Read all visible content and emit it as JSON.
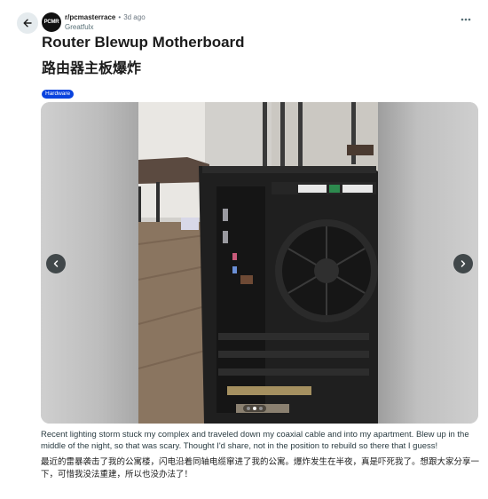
{
  "post": {
    "subreddit": "r/pcmasterrace",
    "separator": "•",
    "time_ago": "3d ago",
    "username": "Greatfulx",
    "avatar_text": "PCMR",
    "title_en": "Router Blewup Motherboard",
    "title_zh": "路由器主板爆炸",
    "flair": "Hardware",
    "flair_color": "#0a43de",
    "body_en": "Recent lighting storm stuck my complex and traveled down my coaxial cable and into my apartment. Blew up in the middle of the night, so that was scary. Thought I'd share, not in the position to rebuild so there that I guess!",
    "body_zh": "最近的雷暴袭击了我的公寓楼，闪电沿着同轴电缆窜进了我的公寓。爆炸发生在半夜，真是吓死我了。想跟大家分享一下，可惜我没法重建，所以也没办法了！"
  },
  "carousel": {
    "slide_count": 3,
    "active_index": 1
  },
  "icons": {
    "back": "arrow-left-icon",
    "more": "more-horizontal-icon",
    "prev": "chevron-left-icon",
    "next": "chevron-right-icon"
  }
}
